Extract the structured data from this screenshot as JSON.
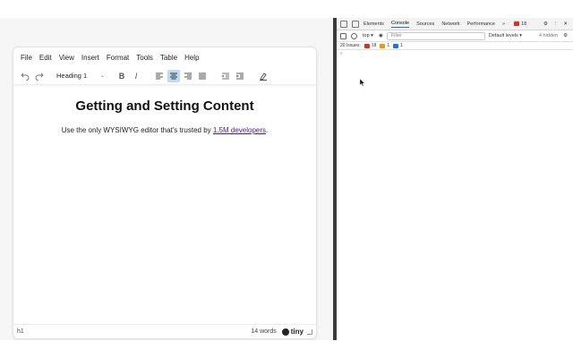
{
  "menubar": {
    "items": [
      "File",
      "Edit",
      "View",
      "Insert",
      "Format",
      "Tools",
      "Table",
      "Help"
    ]
  },
  "toolbar": {
    "block_format": "Heading 1",
    "undo_icon": "undo-icon",
    "redo_icon": "redo-icon",
    "bold_label": "B",
    "italic_label": "I",
    "align_center_active": true
  },
  "document": {
    "title": "Getting and Setting Content",
    "paragraph_prefix": "Use the only WYSIWYG editor that's trusted by ",
    "paragraph_link": "1.5M developers",
    "paragraph_suffix": "."
  },
  "statusbar": {
    "path": "h1",
    "word_count": "14 words",
    "brand": "tiny"
  },
  "devtools": {
    "tabs": [
      "Elements",
      "Console",
      "Sources",
      "Network",
      "Performance"
    ],
    "active_tab": "Console",
    "more": "»",
    "error_count": "18",
    "context": "top",
    "filter_placeholder": "Filter",
    "levels": "Default levels ▾",
    "hidden": "4 hidden",
    "issues_label": "20 Issues:",
    "issues_errors": "18",
    "issues_warnings": "1",
    "issues_info": "1",
    "prompt": "›"
  },
  "colors": {
    "active_button": "#bfd8f4",
    "link": "#4a1a8f",
    "devtools_accent": "#1a73e8"
  }
}
